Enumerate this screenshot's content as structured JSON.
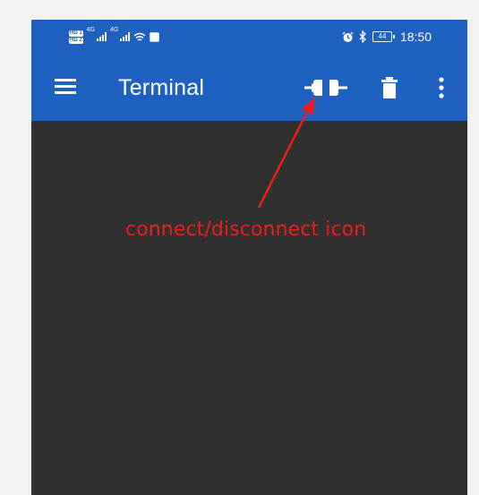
{
  "status_bar": {
    "hd1": "HD 1",
    "hd2": "HD 2",
    "network1": "4G",
    "network2": "4G",
    "battery": "44",
    "time": "18:50",
    "icons": [
      "signal-icon",
      "wifi-icon",
      "app-notification-icon",
      "alarm-icon",
      "bluetooth-icon",
      "battery-icon"
    ]
  },
  "toolbar": {
    "title": "Terminal",
    "actions": [
      "menu-icon",
      "connect-disconnect-icon",
      "trash-icon",
      "more-vert-icon"
    ]
  },
  "annotation": {
    "label": "connect/disconnect icon"
  },
  "colors": {
    "app_bar": "#1f61c1",
    "terminal_bg": "#313131",
    "annotation": "#ef1c1c",
    "page_bg": "#f3f3f4"
  }
}
